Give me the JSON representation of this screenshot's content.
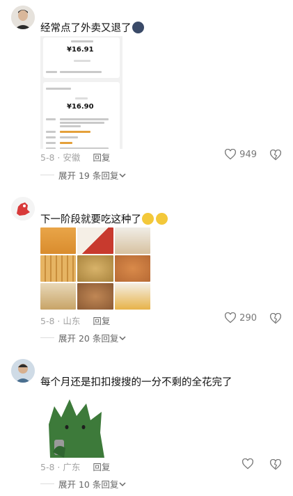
{
  "comments": [
    {
      "text": "经常点了外卖又退了",
      "location": "5-8 · 安徽",
      "reply": "回复",
      "likes": "949",
      "expand": "展开 19 条回复",
      "receipt": {
        "amount1": "¥16.91",
        "amount2": "¥16.90"
      }
    },
    {
      "text": "下一阶段就要吃这种了",
      "location": "5-8 · 山东",
      "reply": "回复",
      "likes": "290",
      "expand": "展开 20 条回复"
    },
    {
      "text": "每个月还是扣扣搜搜的一分不剩的全花完了",
      "location": "5-8 · 广东",
      "reply": "回复",
      "likes": "",
      "expand": "展开 10 条回复"
    }
  ],
  "icons": {
    "like": "heart-outline-icon",
    "dislike": "broken-heart-icon",
    "chevron": "chevron-down-icon"
  }
}
